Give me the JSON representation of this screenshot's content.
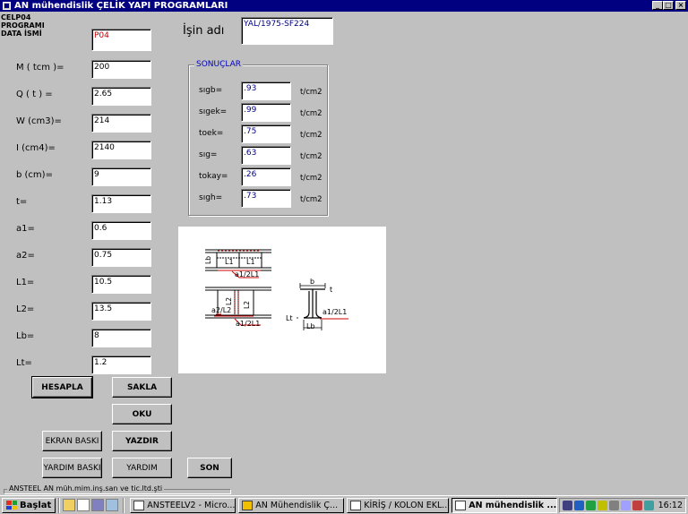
{
  "window": {
    "title": "AN mühendislik  ÇELİK YAPI PROGRAMLARI",
    "min": "_",
    "max": "□",
    "close": "×"
  },
  "header": {
    "prog_line1": "CELP04",
    "prog_line2": "PROGRAMI",
    "prog_line3": "DATA  İSMİ",
    "data_name": "P04",
    "job_label": "İşin adı",
    "job_value": "YAL/1975-SF224"
  },
  "inputs": [
    {
      "label": "M ( tcm )=",
      "value": "200"
    },
    {
      "label": "Q ( t )  =",
      "value": "2.65"
    },
    {
      "label": "W (cm3)=",
      "value": "214"
    },
    {
      "label": "I (cm4)=",
      "value": "2140"
    },
    {
      "label": "b (cm)=",
      "value": "9"
    },
    {
      "label": "t=",
      "value": "1.13"
    },
    {
      "label": "a1=",
      "value": "0.6"
    },
    {
      "label": "a2=",
      "value": "0.75"
    },
    {
      "label": "L1=",
      "value": "10.5"
    },
    {
      "label": "L2=",
      "value": "13.5"
    },
    {
      "label": "Lb=",
      "value": "8"
    },
    {
      "label": "Lt=",
      "value": "1.2"
    }
  ],
  "results": {
    "title": "SONUÇLAR",
    "rows": [
      {
        "label": "sıgb=",
        "value": ".93",
        "unit": "t/cm2"
      },
      {
        "label": "sıgek=",
        "value": ".99",
        "unit": "t/cm2"
      },
      {
        "label": "toek=",
        "value": ".75",
        "unit": "t/cm2"
      },
      {
        "label": "sıg=",
        "value": ".63",
        "unit": "t/cm2"
      },
      {
        "label": "tokay=",
        "value": ".26",
        "unit": "t/cm2"
      },
      {
        "label": "sıgh=",
        "value": ".73",
        "unit": "t/cm2"
      }
    ]
  },
  "diagram": {
    "lb": "Lb",
    "l1a": "L1",
    "l1b": "L1",
    "a1_top": "a1/2L1",
    "a2": "a2/L2",
    "l2": "L2",
    "l2b": "L2",
    "a1_bot": "a1/2L1",
    "b": "b",
    "t": "t",
    "lt": "Lt",
    "a1_right": "a1/2L1",
    "lb2": "Lb"
  },
  "buttons": {
    "hesapla": "HESAPLA",
    "sakla": "SAKLA",
    "oku": "OKU",
    "ekran_baski": "EKRAN BASKI",
    "yazdir": "YAZDIR",
    "yardim_baski": "YARDIM BASKI",
    "yardim": "YARDIM",
    "son": "SON"
  },
  "status": {
    "text": "ANSTEEL   AN müh.mim.inş.san ve tic.ltd.şti"
  },
  "taskbar": {
    "start": "Başlat",
    "tasks": [
      {
        "label": "ANSTEELV2 - Micro..."
      },
      {
        "label": "AN Mühendislik     Ç..."
      },
      {
        "label": "KİRİŞ / KOLON EKL..."
      },
      {
        "label": "AN mühendislik    ..."
      }
    ],
    "clock": "16:12"
  }
}
